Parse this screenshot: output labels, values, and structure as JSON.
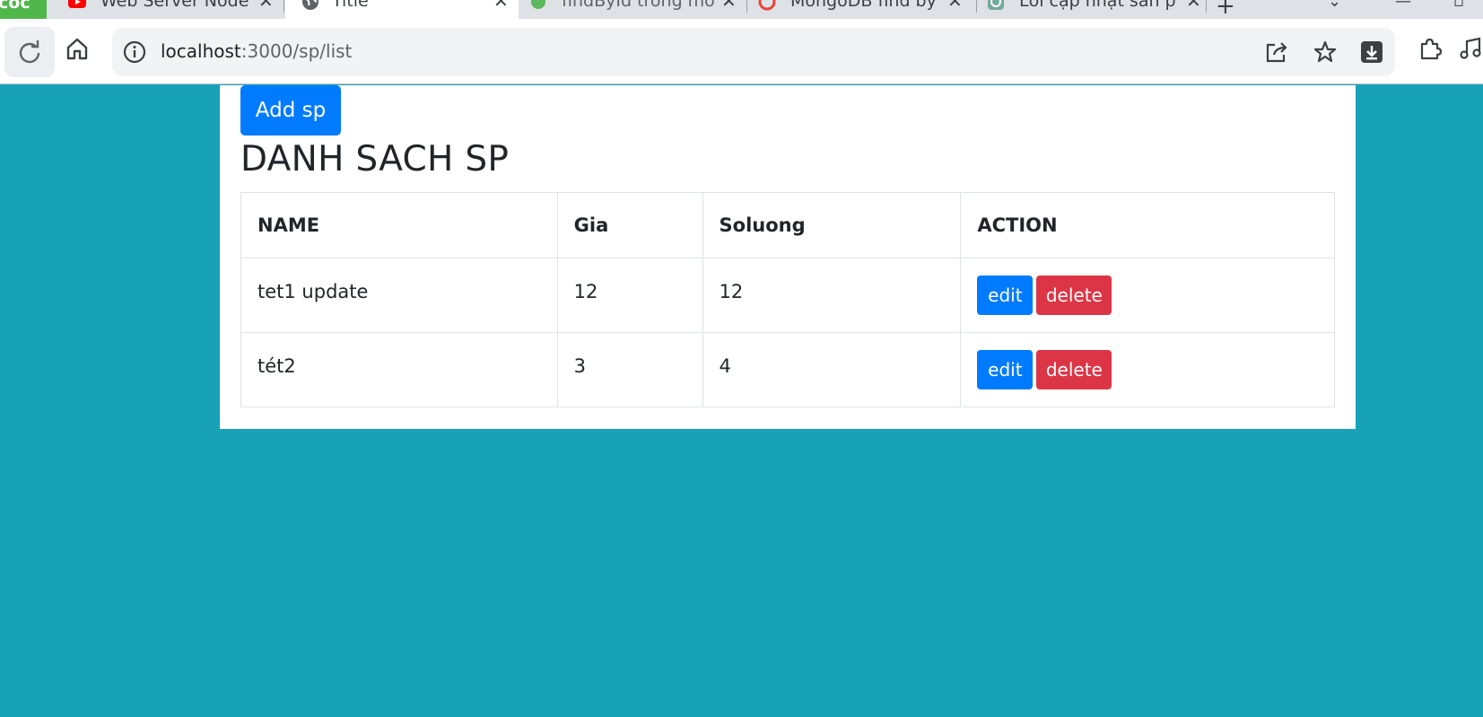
{
  "browser": {
    "tabs": [
      {
        "label": "coc",
        "favicon": "app-icon"
      },
      {
        "label": "Web Server Node",
        "favicon": "youtube-icon"
      },
      {
        "label": "Title",
        "favicon": "globe-icon"
      },
      {
        "label": "findById trong mo",
        "favicon": "app-icon"
      },
      {
        "label": "MongoDB find by",
        "favicon": "app-icon"
      },
      {
        "label": "Lỗi cập nhật sản p",
        "favicon": "chatgpt-icon"
      }
    ],
    "url_host": "localhost",
    "url_path": ":3000/sp/list"
  },
  "page": {
    "add_button": "Add sp",
    "title": "DANH SACH SP",
    "columns": [
      "NAME",
      "Gia",
      "Soluong",
      "ACTION"
    ],
    "rows": [
      {
        "name": "tet1 update",
        "gia": "12",
        "soluong": "12",
        "edit": "edit",
        "delete": "delete"
      },
      {
        "name": "tét2",
        "gia": "3",
        "soluong": "4",
        "edit": "edit",
        "delete": "delete"
      }
    ]
  },
  "colors": {
    "page_bg": "#17a2b8",
    "primary": "#007bff",
    "danger": "#dc3545"
  }
}
